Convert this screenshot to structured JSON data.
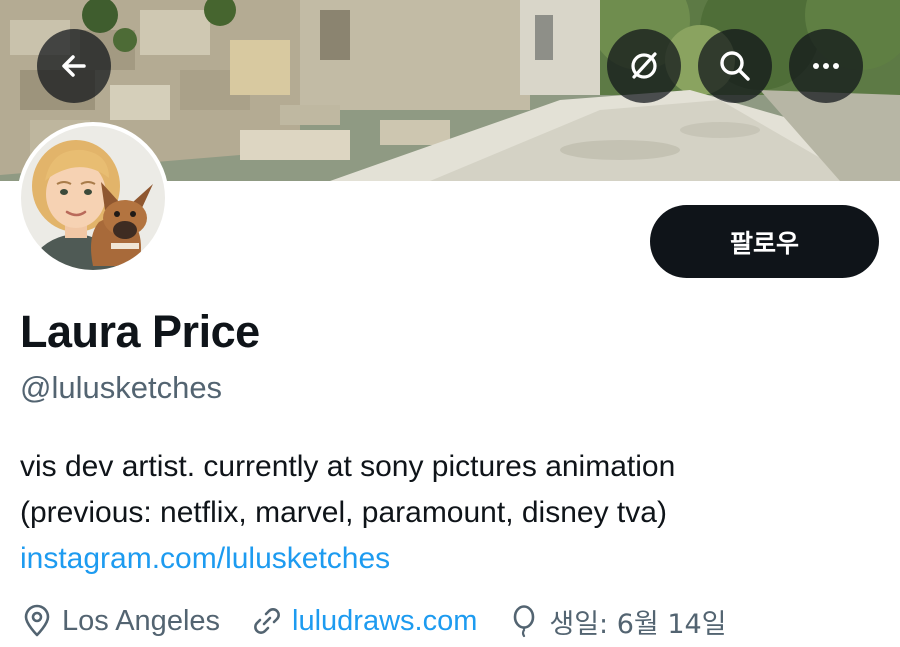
{
  "profile": {
    "name": "Laura Price",
    "handle": "@lulusketches",
    "bio_line1": "vis dev artist. currently at sony pictures animation",
    "bio_line2": "(previous: netflix, marvel, paramount, disney tva)",
    "bio_link": "instagram.com/lulusketches",
    "location": "Los Angeles",
    "website": "luludraws.com",
    "birthday": "생일: 6월 14일"
  },
  "header": {
    "follow_label": "팔로우",
    "icons": [
      "back-arrow-icon",
      "grok-icon",
      "search-icon",
      "more-icon"
    ]
  },
  "meta_icons": [
    "location-pin-icon",
    "link-icon",
    "balloon-icon"
  ],
  "colors": {
    "text": "#0f1419",
    "secondary_text": "#536471",
    "link": "#1d9bf0",
    "follow_button": "#0f1419"
  }
}
